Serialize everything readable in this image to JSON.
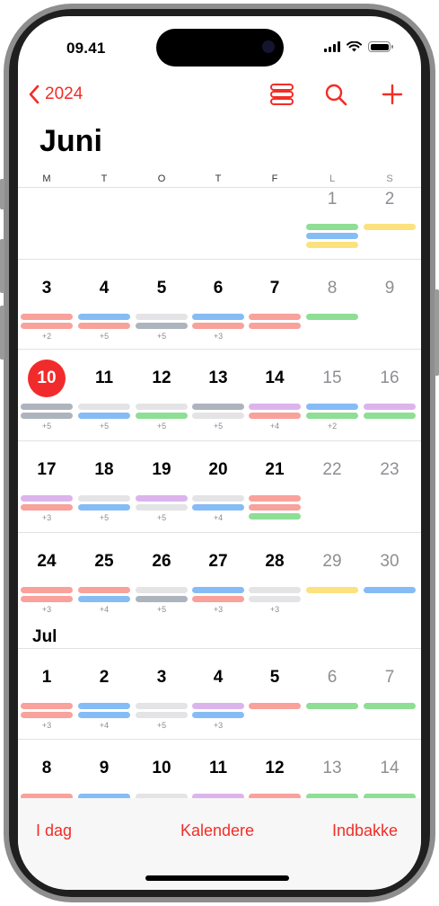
{
  "status": {
    "time": "09.41"
  },
  "nav": {
    "back_label": "2024"
  },
  "month": {
    "title": "Juni"
  },
  "weekdays": [
    "M",
    "T",
    "O",
    "T",
    "F",
    "L",
    "S"
  ],
  "colors": {
    "accent": "#f22d27",
    "today": "#f12b2b",
    "red": "#f9a19b",
    "blue": "#86bcf5",
    "gray": "#aeb4bd",
    "lightgray": "#e4e4e6",
    "green": "#8ede95",
    "purple": "#dcb4ec",
    "yellow": "#fbe27e"
  },
  "weeks": [
    {
      "days": [
        "",
        "",
        "",
        "",
        "",
        "1",
        "2"
      ],
      "events": [
        [],
        [],
        [],
        [],
        [],
        [
          "green",
          "blue",
          "yellow"
        ],
        [
          "yellow"
        ]
      ],
      "more": [
        "",
        "",
        "",
        "",
        "",
        "",
        ""
      ]
    },
    {
      "days": [
        "3",
        "4",
        "5",
        "6",
        "7",
        "8",
        "9"
      ],
      "events": [
        [
          "red",
          "red"
        ],
        [
          "blue",
          "red"
        ],
        [
          "lightgray",
          "gray"
        ],
        [
          "blue",
          "red"
        ],
        [
          "red",
          "red"
        ],
        [
          "green"
        ],
        []
      ],
      "more": [
        "+2",
        "+5",
        "+5",
        "+3",
        "",
        "",
        ""
      ]
    },
    {
      "days": [
        "10",
        "11",
        "12",
        "13",
        "14",
        "15",
        "16"
      ],
      "events": [
        [
          "gray",
          "gray"
        ],
        [
          "lightgray",
          "blue"
        ],
        [
          "lightgray",
          "green"
        ],
        [
          "gray",
          "lightgray"
        ],
        [
          "purple",
          "red"
        ],
        [
          "blue",
          "green"
        ],
        [
          "purple",
          "green"
        ]
      ],
      "more": [
        "+5",
        "+5",
        "+5",
        "+5",
        "+4",
        "+2",
        ""
      ]
    },
    {
      "days": [
        "17",
        "18",
        "19",
        "20",
        "21",
        "22",
        "23"
      ],
      "events": [
        [
          "purple",
          "red"
        ],
        [
          "lightgray",
          "blue"
        ],
        [
          "purple",
          "lightgray"
        ],
        [
          "lightgray",
          "blue"
        ],
        [
          "red",
          "red",
          "green"
        ],
        [],
        []
      ],
      "more": [
        "+3",
        "+5",
        "+5",
        "+4",
        "",
        "",
        ""
      ]
    },
    {
      "days": [
        "24",
        "25",
        "26",
        "27",
        "28",
        "29",
        "30"
      ],
      "events": [
        [
          "red",
          "red"
        ],
        [
          "red",
          "blue"
        ],
        [
          "lightgray",
          "gray"
        ],
        [
          "blue",
          "red"
        ],
        [
          "lightgray",
          "lightgray"
        ],
        [
          "yellow"
        ],
        [
          "blue"
        ]
      ],
      "more": [
        "+3",
        "+4",
        "+5",
        "+3",
        "+3",
        "",
        ""
      ]
    },
    {
      "days": [
        "1",
        "2",
        "3",
        "4",
        "5",
        "6",
        "7"
      ],
      "events": [
        [
          "red",
          "red"
        ],
        [
          "blue",
          "blue"
        ],
        [
          "lightgray",
          "lightgray"
        ],
        [
          "purple",
          "blue"
        ],
        [
          "red"
        ],
        [
          "green"
        ],
        [
          "green"
        ]
      ],
      "more": [
        "+3",
        "+4",
        "+5",
        "+3",
        "",
        "",
        ""
      ]
    },
    {
      "days": [
        "8",
        "9",
        "10",
        "11",
        "12",
        "13",
        "14"
      ],
      "events": [
        [
          "red"
        ],
        [
          "blue"
        ],
        [
          "lightgray"
        ],
        [
          "purple"
        ],
        [
          "red"
        ],
        [
          "green"
        ],
        [
          "green"
        ]
      ],
      "more": [
        "",
        "",
        "",
        "",
        "",
        "",
        ""
      ]
    }
  ],
  "month_label_jul": "Jul",
  "tabbar": {
    "today": "I dag",
    "calendars": "Kalendere",
    "inbox": "Indbakke"
  }
}
